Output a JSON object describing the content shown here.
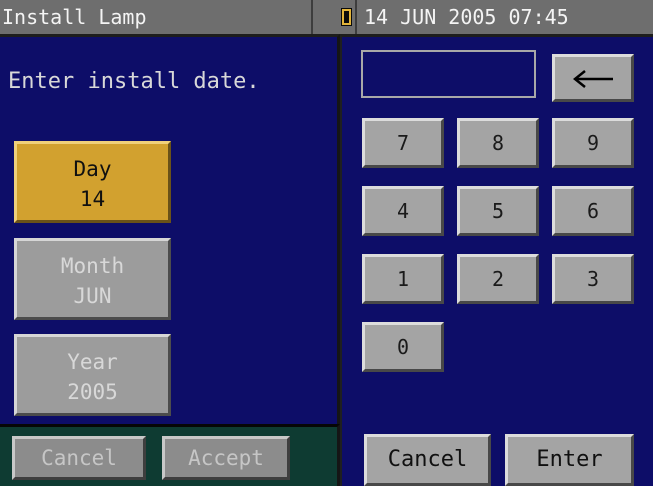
{
  "titlebar": {
    "app_title": "Install Lamp",
    "status_icon": "lamp-icon",
    "datetime": "14 JUN 2005 07:45"
  },
  "left_panel": {
    "prompt": "Enter install date.",
    "fields": {
      "day": {
        "label": "Day",
        "value": "14",
        "active": true
      },
      "month": {
        "label": "Month",
        "value": "JUN",
        "active": false
      },
      "year": {
        "label": "Year",
        "value": "2005",
        "active": false
      }
    },
    "footer": {
      "cancel_label": "Cancel",
      "accept_label": "Accept"
    }
  },
  "keypad": {
    "entry_value": "",
    "backspace_icon": "left-arrow-icon",
    "keys": {
      "k7": "7",
      "k8": "8",
      "k9": "9",
      "k4": "4",
      "k5": "5",
      "k6": "6",
      "k1": "1",
      "k2": "2",
      "k3": "3",
      "k0": "0"
    },
    "cancel_label": "Cancel",
    "enter_label": "Enter"
  },
  "colors": {
    "panel_background": "#0d0d68",
    "active_field": "#d2a12f",
    "button_face": "#a4a4a4",
    "titlebar": "#6e6e6e",
    "footer_background": "#0e3b32"
  }
}
